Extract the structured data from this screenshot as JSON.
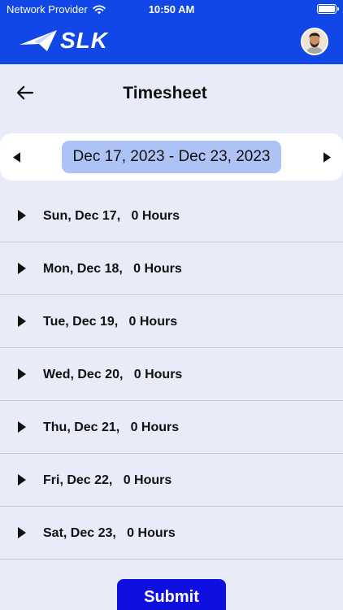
{
  "status_bar": {
    "carrier": "Network Provider",
    "time": "10:50 AM"
  },
  "app_bar": {
    "logo_text": "SLK"
  },
  "header": {
    "title": "Timesheet"
  },
  "week_nav": {
    "range": "Dec 17, 2023 - Dec 23, 2023"
  },
  "days": [
    {
      "label": "Sun, Dec 17,   0 Hours"
    },
    {
      "label": "Mon, Dec 18,   0 Hours"
    },
    {
      "label": "Tue, Dec 19,   0 Hours"
    },
    {
      "label": "Wed, Dec 20,   0 Hours"
    },
    {
      "label": "Thu, Dec 21,   0 Hours"
    },
    {
      "label": "Fri, Dec 22,   0 Hours"
    },
    {
      "label": "Sat, Dec 23,   0 Hours"
    }
  ],
  "submit_label": "Submit",
  "colors": {
    "primary": "#1047e6",
    "background": "#e8ecf8",
    "range_pill": "#aec3f5",
    "submit": "#0f0fe0"
  },
  "icons": {
    "wifi": "wifi-icon",
    "battery": "battery-icon",
    "back": "arrow-left-icon",
    "prev": "triangle-left-icon",
    "next": "triangle-right-icon",
    "expand": "triangle-right-icon"
  }
}
